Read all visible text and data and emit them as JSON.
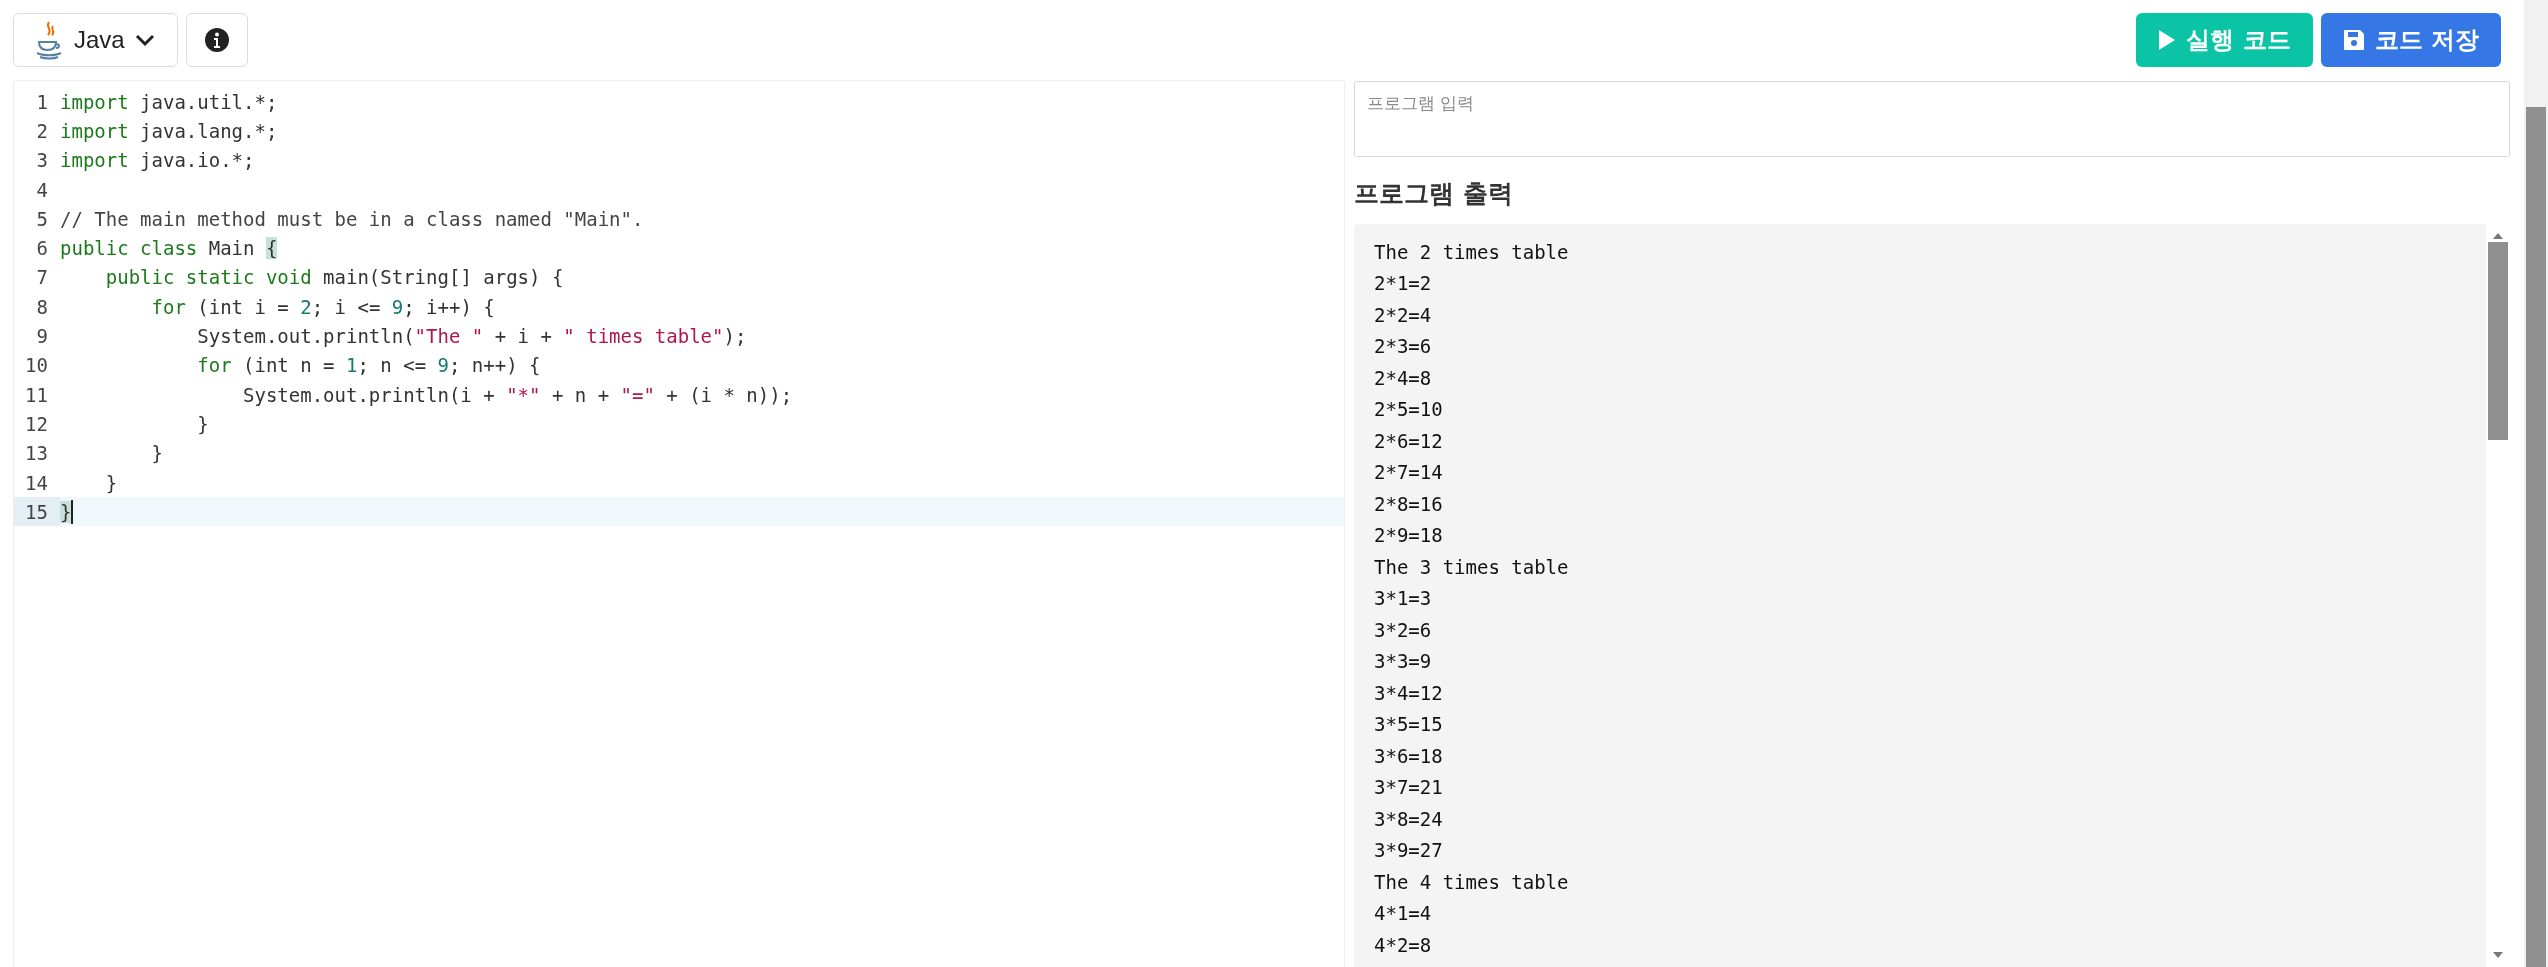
{
  "toolbar": {
    "language": "Java",
    "run_button": "실행 코드",
    "save_button": "코드 저장"
  },
  "editor": {
    "lines": [
      {
        "number": "1",
        "active": false,
        "tokens": [
          {
            "kind": "keyword",
            "text": "import"
          },
          {
            "kind": "plain",
            "text": " java.util.*;"
          }
        ]
      },
      {
        "number": "2",
        "active": false,
        "tokens": [
          {
            "kind": "keyword",
            "text": "import"
          },
          {
            "kind": "plain",
            "text": " java.lang.*;"
          }
        ]
      },
      {
        "number": "3",
        "active": false,
        "tokens": [
          {
            "kind": "keyword",
            "text": "import"
          },
          {
            "kind": "plain",
            "text": " java.io.*;"
          }
        ]
      },
      {
        "number": "4",
        "active": false
      },
      {
        "number": "5",
        "active": false,
        "tokens": [
          {
            "kind": "comment",
            "text": "// The main method must be in a class named \"Main\"."
          }
        ]
      },
      {
        "number": "6",
        "active": false,
        "tokens": [
          {
            "kind": "keyword",
            "text": "public"
          },
          {
            "kind": "keyword",
            "text": " class"
          },
          {
            "kind": "plain",
            "text": " Main "
          },
          {
            "kind": "bracket",
            "text": "{",
            "matched": true
          }
        ]
      },
      {
        "number": "7",
        "active": false,
        "tokens": [
          {
            "kind": "keyword",
            "text": "    public"
          },
          {
            "kind": "keyword",
            "text": " static"
          },
          {
            "kind": "keyword",
            "text": " void"
          },
          {
            "kind": "plain",
            "text": " main(String[] args) {"
          }
        ]
      },
      {
        "number": "8",
        "active": false,
        "tokens": [
          {
            "kind": "keyword",
            "text": "        for"
          },
          {
            "kind": "plain",
            "text": " (int i = "
          },
          {
            "kind": "number",
            "text": "2"
          },
          {
            "kind": "plain",
            "text": "; i <= "
          },
          {
            "kind": "number",
            "text": "9"
          },
          {
            "kind": "plain",
            "text": "; i++) {"
          }
        ]
      },
      {
        "number": "9",
        "active": false,
        "tokens": [
          {
            "kind": "plain",
            "text": "            System.out.println("
          },
          {
            "kind": "string",
            "text": "\"The \""
          },
          {
            "kind": "plain",
            "text": " + i + "
          },
          {
            "kind": "string",
            "text": "\" times table\""
          },
          {
            "kind": "plain",
            "text": ");"
          }
        ]
      },
      {
        "number": "10",
        "active": false,
        "tokens": [
          {
            "kind": "keyword",
            "text": "            for"
          },
          {
            "kind": "plain",
            "text": " (int n = "
          },
          {
            "kind": "number",
            "text": "1"
          },
          {
            "kind": "plain",
            "text": "; n <= "
          },
          {
            "kind": "number",
            "text": "9"
          },
          {
            "kind": "plain",
            "text": "; n++) {"
          }
        ]
      },
      {
        "number": "11",
        "active": false,
        "tokens": [
          {
            "kind": "plain",
            "text": "                System.out.println(i + "
          },
          {
            "kind": "string",
            "text": "\"*\""
          },
          {
            "kind": "plain",
            "text": " + n + "
          },
          {
            "kind": "string",
            "text": "\"=\""
          },
          {
            "kind": "plain",
            "text": " + (i * n));"
          }
        ]
      },
      {
        "number": "12",
        "active": false,
        "tokens": [
          {
            "kind": "plain",
            "text": "            }"
          }
        ]
      },
      {
        "number": "13",
        "active": false,
        "tokens": [
          {
            "kind": "plain",
            "text": "        }"
          }
        ]
      },
      {
        "number": "14",
        "active": false,
        "tokens": [
          {
            "kind": "plain",
            "text": "    }"
          }
        ]
      },
      {
        "number": "15",
        "active": true,
        "tokens": [
          {
            "kind": "bracket",
            "text": "}",
            "matched": true
          }
        ]
      }
    ]
  },
  "input": {
    "placeholder": "프로그램 입력"
  },
  "output": {
    "title": "프로그램 출력",
    "lines": [
      "The 2 times table",
      "2*1=2",
      "2*2=4",
      "2*3=6",
      "2*4=8",
      "2*5=10",
      "2*6=12",
      "2*7=14",
      "2*8=16",
      "2*9=18",
      "The 3 times table",
      "3*1=3",
      "3*2=6",
      "3*3=9",
      "3*4=12",
      "3*5=15",
      "3*6=18",
      "3*7=21",
      "3*8=24",
      "3*9=27",
      "The 4 times table",
      "4*1=4",
      "4*2=8"
    ]
  }
}
